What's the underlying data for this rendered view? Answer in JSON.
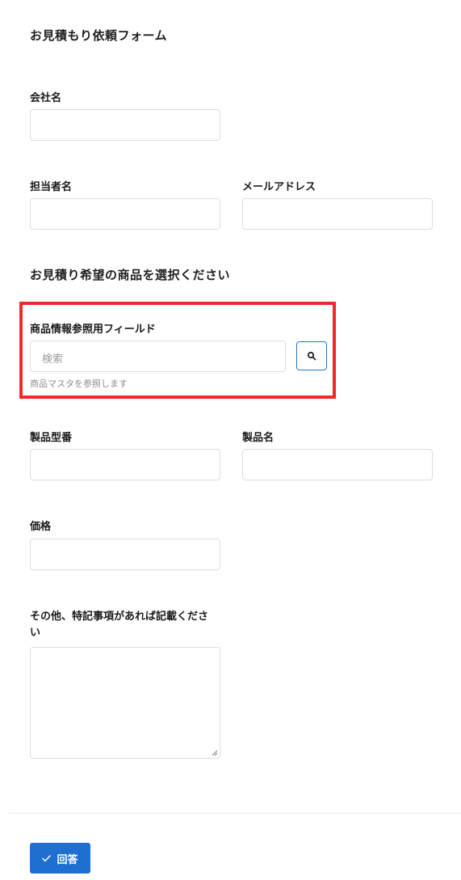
{
  "form": {
    "title": "お見積もり依頼フォーム",
    "company": {
      "label": "会社名",
      "value": ""
    },
    "contact_name": {
      "label": "担当者名",
      "value": ""
    },
    "email": {
      "label": "メールアドレス",
      "value": ""
    },
    "section_title": "お見積り希望の商品を選択ください",
    "product_lookup": {
      "label": "商品情報参照用フィールド",
      "placeholder": "検索",
      "helper": "商品マスタを参照します",
      "search_icon": "search-icon"
    },
    "model_number": {
      "label": "製品型番",
      "value": ""
    },
    "product_name": {
      "label": "製品名",
      "value": ""
    },
    "price": {
      "label": "価格",
      "value": ""
    },
    "notes": {
      "label_line1": "その他、特記事項があれば記載くださ",
      "label_line2": "い",
      "value": ""
    },
    "submit": {
      "label": "回答",
      "icon": "check-icon"
    }
  },
  "colors": {
    "accent": "#1f6fd1",
    "highlight": "#ef2a2a",
    "border": "#dcdde0"
  }
}
